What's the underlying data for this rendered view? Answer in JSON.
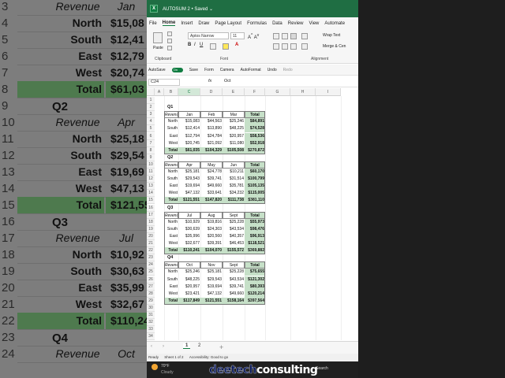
{
  "window": {
    "title": "AUTOSUM 2 • Saved ⌄"
  },
  "menu": [
    "File",
    "Home",
    "Insert",
    "Draw",
    "Page Layout",
    "Formulas",
    "Data",
    "Review",
    "View",
    "Automate"
  ],
  "menu_active_index": 1,
  "ribbon": {
    "paste": "Paste",
    "font_name": "Aptos Narrow",
    "font_size": "11",
    "wrap_text": "Wrap Text",
    "merge": "Merge & Cen",
    "group_clipboard": "Clipboard",
    "group_font": "Font",
    "group_alignment": "Alignment"
  },
  "qat": {
    "autosave": "AutoSave",
    "autosave_state": "On",
    "save": "Save",
    "form": "Form",
    "camera": "Camera",
    "autoformat": "AutoFormat",
    "undo": "Undo",
    "redo": "Redo"
  },
  "formula_bar": {
    "name_box": "C24",
    "fx": "fx",
    "value": "Oct"
  },
  "columns": [
    "A",
    "B",
    "C",
    "D",
    "E",
    "F",
    "G",
    "H",
    "I"
  ],
  "quarters": [
    {
      "label": "Q1",
      "months": [
        "Jan",
        "Feb",
        "Mar"
      ],
      "rows": [
        {
          "region": "North",
          "v": [
            "$15,083",
            "$44,563",
            "$25,246"
          ],
          "total": "$84,891"
        },
        {
          "region": "South",
          "v": [
            "$12,414",
            "$13,890",
            "$48,225"
          ],
          "total": "$74,528"
        },
        {
          "region": "East",
          "v": [
            "$12,794",
            "$24,784",
            "$20,957"
          ],
          "total": "$58,536"
        },
        {
          "region": "West",
          "v": [
            "$20,745",
            "$21,092",
            "$11,080"
          ],
          "total": "$52,918"
        }
      ],
      "totals": [
        "$61,035",
        "$104,329",
        "$105,508",
        "$270,872"
      ]
    },
    {
      "label": "Q2",
      "months": [
        "Apr",
        "May",
        "Jun"
      ],
      "rows": [
        {
          "region": "North",
          "v": [
            "$25,181",
            "$24,778",
            "$10,211"
          ],
          "total": "$60,170"
        },
        {
          "region": "South",
          "v": [
            "$29,543",
            "$39,741",
            "$31,514"
          ],
          "total": "$100,799"
        },
        {
          "region": "East",
          "v": [
            "$19,694",
            "$49,660",
            "$35,781"
          ],
          "total": "$105,135"
        },
        {
          "region": "West",
          "v": [
            "$47,132",
            "$33,641",
            "$34,232"
          ],
          "total": "$115,005"
        }
      ],
      "totals": [
        "$121,551",
        "$147,820",
        "$111,738",
        "$381,110"
      ]
    },
    {
      "label": "Q3",
      "months": [
        "Jul",
        "Aug",
        "Sept"
      ],
      "rows": [
        {
          "region": "North",
          "v": [
            "$10,929",
            "$19,816",
            "$25,228"
          ],
          "total": "$55,973"
        },
        {
          "region": "South",
          "v": [
            "$30,639",
            "$24,303",
            "$43,534"
          ],
          "total": "$98,476"
        },
        {
          "region": "East",
          "v": [
            "$35,996",
            "$20,560",
            "$40,357"
          ],
          "total": "$96,913"
        },
        {
          "region": "West",
          "v": [
            "$32,677",
            "$39,391",
            "$46,453"
          ],
          "total": "$118,521"
        }
      ],
      "totals": [
        "$110,241",
        "$104,070",
        "$155,572",
        "$369,882"
      ]
    },
    {
      "label": "Q4",
      "months": [
        "Oct",
        "Nov",
        "Sept"
      ],
      "rows": [
        {
          "region": "North",
          "v": [
            "$25,246",
            "$25,181",
            "$25,228"
          ],
          "total": "$75,655"
        },
        {
          "region": "South",
          "v": [
            "$48,225",
            "$29,543",
            "$43,534"
          ],
          "total": "$121,302"
        },
        {
          "region": "East",
          "v": [
            "$20,957",
            "$19,694",
            "$39,741"
          ],
          "total": "$80,393"
        },
        {
          "region": "West",
          "v": [
            "$23,421",
            "$47,132",
            "$49,660"
          ],
          "total": "$120,214"
        }
      ],
      "totals": [
        "$117,849",
        "$121,551",
        "$158,164",
        "$397,564"
      ]
    }
  ],
  "header_label": "Revenue",
  "total_label": "Total",
  "sheet_tabs": [
    "1",
    "2"
  ],
  "active_sheet_index": 0,
  "status": {
    "ready": "Ready",
    "sheet": "Sheet 1 of 2",
    "accessibility": "Accessibility: Good to go"
  },
  "taskbar": {
    "temp": "70°F",
    "weather": "Cloudy",
    "search": "Search"
  },
  "background": {
    "rows": [
      {
        "n": "3",
        "label": "Revenue",
        "val": "Jan",
        "kind": "head"
      },
      {
        "n": "4",
        "label": "North",
        "val": "$15,08"
      },
      {
        "n": "5",
        "label": "South",
        "val": "$12,41"
      },
      {
        "n": "6",
        "label": "East",
        "val": "$12,79"
      },
      {
        "n": "7",
        "label": "West",
        "val": "$20,74"
      },
      {
        "n": "8",
        "label": "Total",
        "val": "$61,03",
        "kind": "total"
      },
      {
        "n": "9",
        "q": "Q2"
      },
      {
        "n": "10",
        "label": "Revenue",
        "val": "Apr",
        "kind": "head"
      },
      {
        "n": "11",
        "label": "North",
        "val": "$25,18"
      },
      {
        "n": "12",
        "label": "South",
        "val": "$29,54"
      },
      {
        "n": "13",
        "label": "East",
        "val": "$19,69"
      },
      {
        "n": "14",
        "label": "West",
        "val": "$47,13"
      },
      {
        "n": "15",
        "label": "Total",
        "val": "$121,55",
        "kind": "total"
      },
      {
        "n": "16",
        "q": "Q3"
      },
      {
        "n": "17",
        "label": "Revenue",
        "val": "Jul",
        "kind": "head"
      },
      {
        "n": "18",
        "label": "North",
        "val": "$10,92"
      },
      {
        "n": "19",
        "label": "South",
        "val": "$30,63"
      },
      {
        "n": "20",
        "label": "East",
        "val": "$35,99"
      },
      {
        "n": "21",
        "label": "West",
        "val": "$32,67"
      },
      {
        "n": "22",
        "label": "Total",
        "val": "$110,24",
        "kind": "total"
      },
      {
        "n": "23",
        "q": "Q4"
      },
      {
        "n": "24",
        "label": "Revenue",
        "val": "Oct",
        "kind": "head"
      }
    ]
  },
  "watermark": {
    "part1": "deetech",
    "part2": "consulting"
  }
}
